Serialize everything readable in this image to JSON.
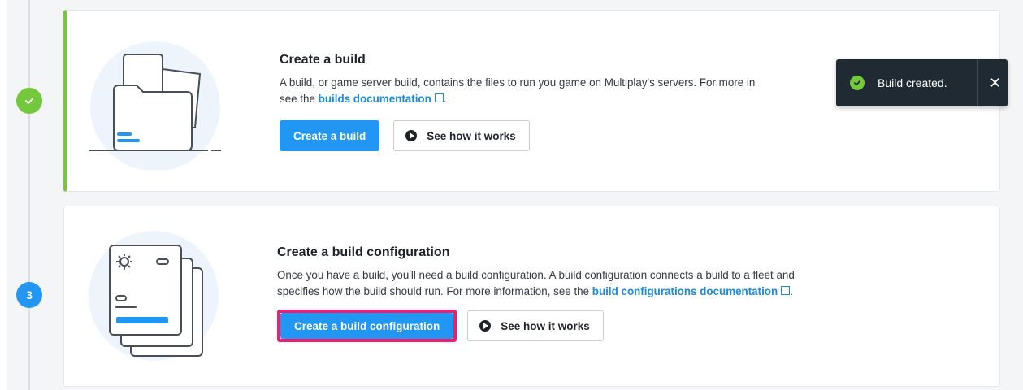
{
  "steps": [
    {
      "status": "complete",
      "title": "Create a build",
      "description_prefix": "A build, or game server build, contains the files to run you game on Multiplay's servers. For more in",
      "description_line2_prefix": "see the ",
      "doc_link": "builds documentation",
      "description_suffix": ".",
      "primary_label": "Create a build",
      "secondary_label": "See how it works"
    },
    {
      "number": "3",
      "status": "current",
      "title": "Create a build configuration",
      "description_line1": "Once you have a build, you'll need a build configuration. A build configuration connects a build to a fleet and",
      "description_line2_prefix": "specifies how the build should run. For more information, see the ",
      "doc_link": "build configurations documentation",
      "description_suffix": ".",
      "primary_label": "Create a build configuration",
      "secondary_label": "See how it works"
    }
  ],
  "toast": {
    "message": "Build created.",
    "close": "✕"
  },
  "colors": {
    "accent": "#2196f3",
    "success": "#73c83c",
    "highlight": "#ec1f75",
    "toast_bg": "#1f2a33"
  }
}
